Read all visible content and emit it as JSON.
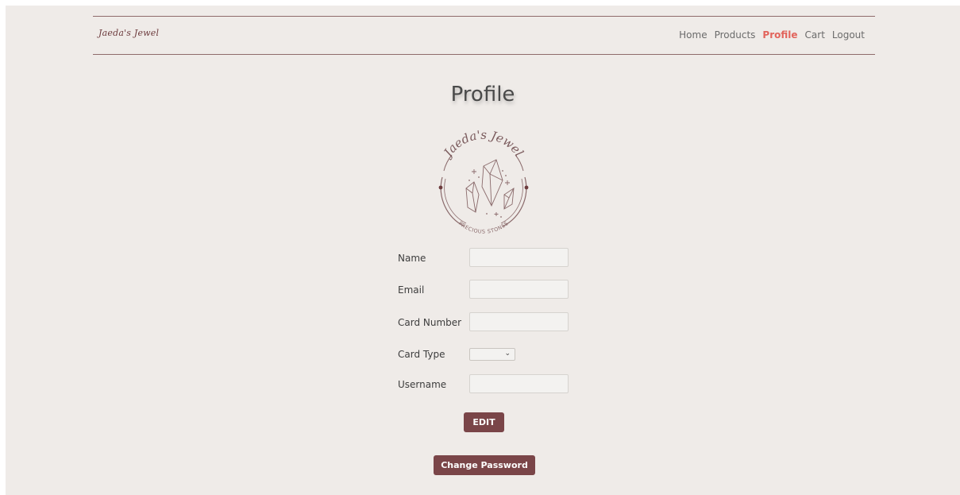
{
  "brand": {
    "name": "Jaeda's Jewel"
  },
  "nav": {
    "items": [
      {
        "label": "Home"
      },
      {
        "label": "Products"
      },
      {
        "label": "Profile",
        "active": true
      },
      {
        "label": "Cart"
      },
      {
        "label": "Logout"
      }
    ]
  },
  "page": {
    "title": "Profile"
  },
  "logo": {
    "top_text": "Jaeda's Jewel",
    "bottom_text": "PRECIOUS STONES",
    "icon": "crystal-gems-icon"
  },
  "form": {
    "name_label": "Name",
    "name_value": "",
    "email_label": "Email",
    "email_value": "",
    "card_number_label": "Card Number",
    "card_number_value": "",
    "card_type_label": "Card Type",
    "card_type_value": "",
    "username_label": "Username",
    "username_value": ""
  },
  "buttons": {
    "edit": "EDIT",
    "change_password": "Change Password"
  },
  "colors": {
    "background": "#efebe8",
    "accent": "#7a4548",
    "active_nav": "#e2645c",
    "nav_border": "#8f6b6b"
  }
}
